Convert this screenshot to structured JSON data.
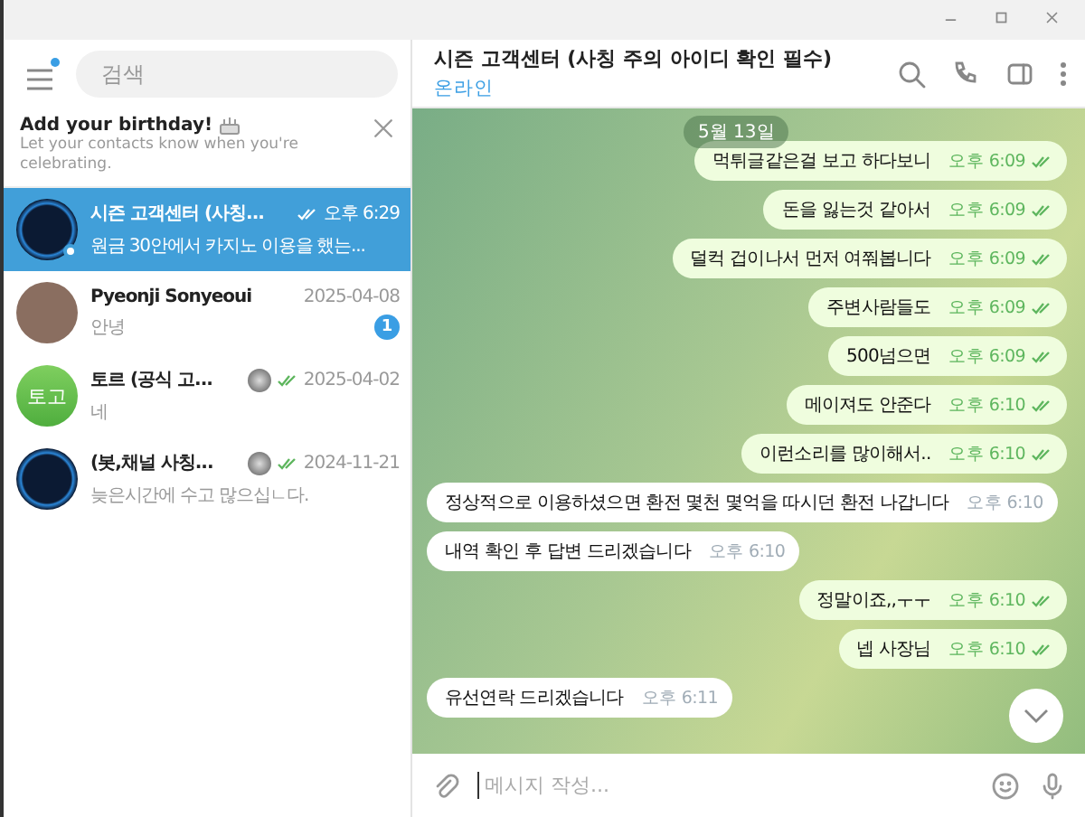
{
  "sidebar": {
    "search": {
      "placeholder": "검색"
    },
    "menu_badge": true,
    "banner": {
      "title": "Add your birthday!",
      "text": "Let your contacts know when you're celebrating."
    },
    "chats": [
      {
        "name": "시즌 고객센터 (사칭...",
        "preview": "원금 30안에서 카지노 이용을 했는...",
        "time": "오후 6:29",
        "read": true,
        "selected": true,
        "online": true,
        "kind": "logo",
        "status_icon": false
      },
      {
        "name": "Pyeonji Sonyeoui",
        "preview": "안녕",
        "time": "2025-04-08",
        "read": false,
        "selected": false,
        "online": false,
        "kind": "photo",
        "unread": "1",
        "status_icon": false
      },
      {
        "name": "토르 (공식 고...",
        "preview": "네",
        "time": "2025-04-02",
        "read": true,
        "selected": false,
        "online": false,
        "kind": "initials",
        "avatar_text": "토고",
        "status_icon": true
      },
      {
        "name": "(봇,채널 사칭...",
        "preview": "늦은시간에 수고 많으십ㄴ다.",
        "time": "2024-11-21",
        "read": true,
        "selected": false,
        "online": false,
        "kind": "logo",
        "status_icon": true
      }
    ]
  },
  "chat": {
    "title": "시즌 고객센터 (사칭 주의 아이디 확인 필수)",
    "status": "온라인",
    "date": "5월 13일",
    "messages": [
      {
        "text": "먹튀글같은걸 보고 하다보니",
        "time": "오후 6:09",
        "outgoing": true,
        "read": true
      },
      {
        "text": "돈을 잃는것 같아서",
        "time": "오후 6:09",
        "outgoing": true,
        "read": true
      },
      {
        "text": "덜컥 겁이나서 먼저 여쭤봅니다",
        "time": "오후 6:09",
        "outgoing": true,
        "read": true
      },
      {
        "text": "주변사람들도",
        "time": "오후 6:09",
        "outgoing": true,
        "read": true
      },
      {
        "text": "500넘으면",
        "time": "오후 6:09",
        "outgoing": true,
        "read": true
      },
      {
        "text": "메이져도 안준다",
        "time": "오후 6:10",
        "outgoing": true,
        "read": true
      },
      {
        "text": "이런소리를 많이해서..",
        "time": "오후 6:10",
        "outgoing": true,
        "read": true
      },
      {
        "text": "정상적으로 이용하셨으면 환전 몇천 몇억을 따시던 환전 나갑니다",
        "time": "오후 6:10",
        "outgoing": false,
        "read": false
      },
      {
        "text": "내역 확인 후 답변 드리겠습니다",
        "time": "오후 6:10",
        "outgoing": false,
        "read": false
      },
      {
        "text": "정말이죠,,ㅜㅜ",
        "time": "오후 6:10",
        "outgoing": true,
        "read": true
      },
      {
        "text": "넵 사장님",
        "time": "오후 6:10",
        "outgoing": true,
        "read": true
      },
      {
        "text": "유선연락 드리겠습니다",
        "time": "오후 6:11",
        "outgoing": false,
        "read": false
      }
    ],
    "composer": {
      "placeholder": "메시지 작성..."
    }
  }
}
